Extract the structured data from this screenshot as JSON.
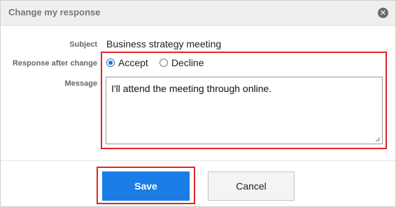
{
  "dialog": {
    "title": "Change my response",
    "close_glyph": "✕"
  },
  "form": {
    "subject_label": "Subject",
    "subject_value": "Business strategy meeting",
    "response_label": "Response after change",
    "response_options": [
      {
        "label": "Accept",
        "selected": true
      },
      {
        "label": "Decline",
        "selected": false
      }
    ],
    "message_label": "Message",
    "message_value": "I'll attend the meeting through online."
  },
  "buttons": {
    "save_label": "Save",
    "cancel_label": "Cancel"
  },
  "colors": {
    "accent": "#1a7de6",
    "highlight": "#e02424"
  }
}
